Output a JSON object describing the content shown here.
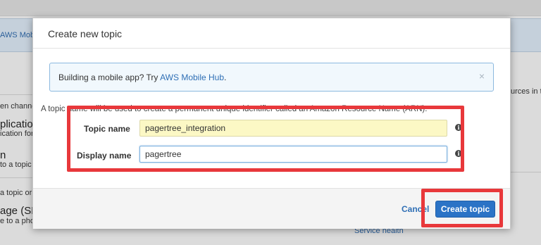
{
  "background": {
    "nav_link": "AWS Mobile",
    "fragments": [
      "en channe",
      "plication",
      "ication for",
      "n",
      "to a topic",
      "a topic or s",
      "age (SM",
      "e to a phor"
    ],
    "right_fragment": "urces in th",
    "service_health": "Service health"
  },
  "modal": {
    "title": "Create new topic",
    "info": {
      "text": "Building a mobile app? Try ",
      "link": "AWS Mobile Hub",
      "suffix": ".",
      "close": "×"
    },
    "description": "A topic name will be used to create a permanent unique identifier called an Amazon Resource Name (ARN).",
    "fields": {
      "topic_name_label": "Topic name",
      "topic_name_value": "pagertree_integration",
      "display_name_label": "Display name",
      "display_name_value": "pagertree",
      "info_glyph": "i"
    },
    "footer": {
      "cancel": "Cancel",
      "create": "Create topic"
    }
  },
  "colors": {
    "annotation": "#e8383b",
    "primary_button": "#2b73c6",
    "link": "#2f6fb5"
  }
}
